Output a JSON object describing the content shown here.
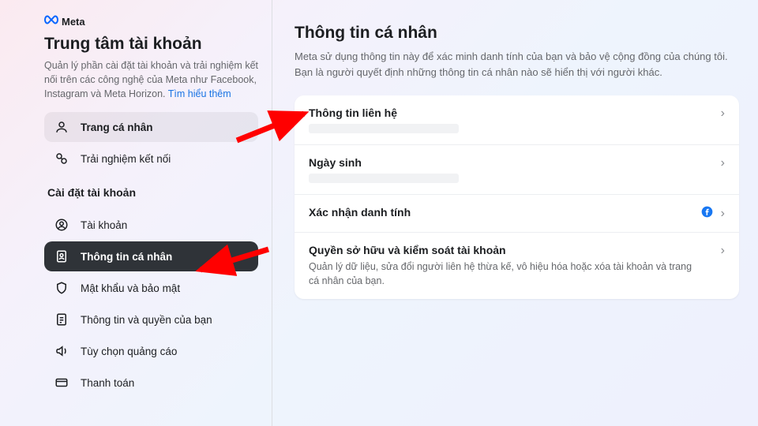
{
  "brand": {
    "name": "Meta"
  },
  "sidebar": {
    "title": "Trung tâm tài khoản",
    "desc_prefix": "Quản lý phần cài đặt tài khoản và trải nghiệm kết nối trên các công nghệ của Meta như Facebook, Instagram và Meta Horizon. ",
    "desc_link": "Tìm hiểu thêm",
    "top_items": [
      {
        "label": "Trang cá nhân"
      },
      {
        "label": "Trải nghiệm kết nối"
      }
    ],
    "section_label": "Cài đặt tài khoản",
    "items": [
      {
        "label": "Tài khoản"
      },
      {
        "label": "Thông tin cá nhân"
      },
      {
        "label": "Mật khẩu và bảo mật"
      },
      {
        "label": "Thông tin và quyền của bạn"
      },
      {
        "label": "Tùy chọn quảng cáo"
      },
      {
        "label": "Thanh toán"
      }
    ]
  },
  "main": {
    "title": "Thông tin cá nhân",
    "desc": "Meta sử dụng thông tin này để xác minh danh tính của bạn và bảo vệ cộng đồng của chúng tôi. Bạn là người quyết định những thông tin cá nhân nào sẽ hiển thị với người khác.",
    "rows": [
      {
        "title": "Thông tin liên hệ",
        "sub": ""
      },
      {
        "title": "Ngày sinh",
        "sub": ""
      },
      {
        "title": "Xác nhận danh tính",
        "sub": ""
      },
      {
        "title": "Quyền sở hữu và kiểm soát tài khoản",
        "sub": "Quản lý dữ liệu, sửa đổi người liên hệ thừa kế, vô hiệu hóa hoặc xóa tài khoản và trang cá nhân của bạn."
      }
    ]
  }
}
